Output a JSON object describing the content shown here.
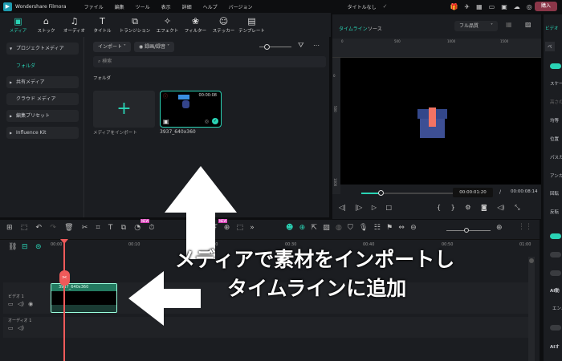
{
  "app": {
    "name": "Wondershare Filmora",
    "project_title": "タイトルなし",
    "buy_label": "購入"
  },
  "menu": [
    "ファイル",
    "編集",
    "ツール",
    "表示",
    "詳細",
    "ヘルプ",
    "バージョン"
  ],
  "toolbar": [
    {
      "label": "メディア",
      "icon": "▣"
    },
    {
      "label": "ストック",
      "icon": "⌂"
    },
    {
      "label": "オーディオ",
      "icon": "♫"
    },
    {
      "label": "タイトル",
      "icon": "T"
    },
    {
      "label": "トランジション",
      "icon": "⧉"
    },
    {
      "label": "エフェクト",
      "icon": "✧"
    },
    {
      "label": "フィルター",
      "icon": "❀"
    },
    {
      "label": "ステッカー",
      "icon": "☺"
    },
    {
      "label": "テンプレート",
      "icon": "▤"
    }
  ],
  "sidebar": {
    "project_media": "プロジェクトメディア",
    "folder": "フォルダ",
    "shared_media": "共有メディア",
    "cloud_media": "クラウド メディア",
    "presets": "編集プリセット",
    "influence_kit": "Influence Kit"
  },
  "media": {
    "import_btn": "インポート",
    "record_btn": "録画/録音",
    "search_placeholder": "検索",
    "folder_heading": "フォルダ",
    "import_tile_label": "メディアをインポート",
    "clip_name": "3937_640x360",
    "clip_duration": "00:00:08"
  },
  "preview": {
    "tab_timeline": "タイムライン",
    "tab_source": "ソース",
    "quality": "フル品質",
    "ruler": [
      "0",
      "500",
      "1000",
      "1500"
    ],
    "vruler": [
      "0",
      "500",
      "1000"
    ],
    "current_time": "00:00:01:20",
    "separator": "/",
    "total_time": "00:00:08:14",
    "progress": 0.2
  },
  "right_panel": {
    "tab": "ビデオ",
    "labels": [
      "ベ",
      "スケー",
      "高さの",
      "均等",
      "位置",
      "パスカ",
      "アンカ",
      "回転",
      "反転",
      "AI動",
      "エンハ",
      "AIオ"
    ]
  },
  "timeline": {
    "ticks": [
      "00:00",
      "00:10",
      "00:20",
      "00:30",
      "00:40",
      "00:50",
      "01:00"
    ],
    "video_track": "ビデオ 1",
    "audio_track": "オーディオ 1",
    "clip_label": "3937_640x360",
    "new_badge": "NEW",
    "zoom_level": 0.45
  },
  "overlay": {
    "line1": "メディアで素材をインポートし",
    "line2": "タイムラインに追加"
  },
  "colors": {
    "accent": "#2ad3b5",
    "playhead": "#ef5a5a",
    "buy": "#8a3648"
  }
}
